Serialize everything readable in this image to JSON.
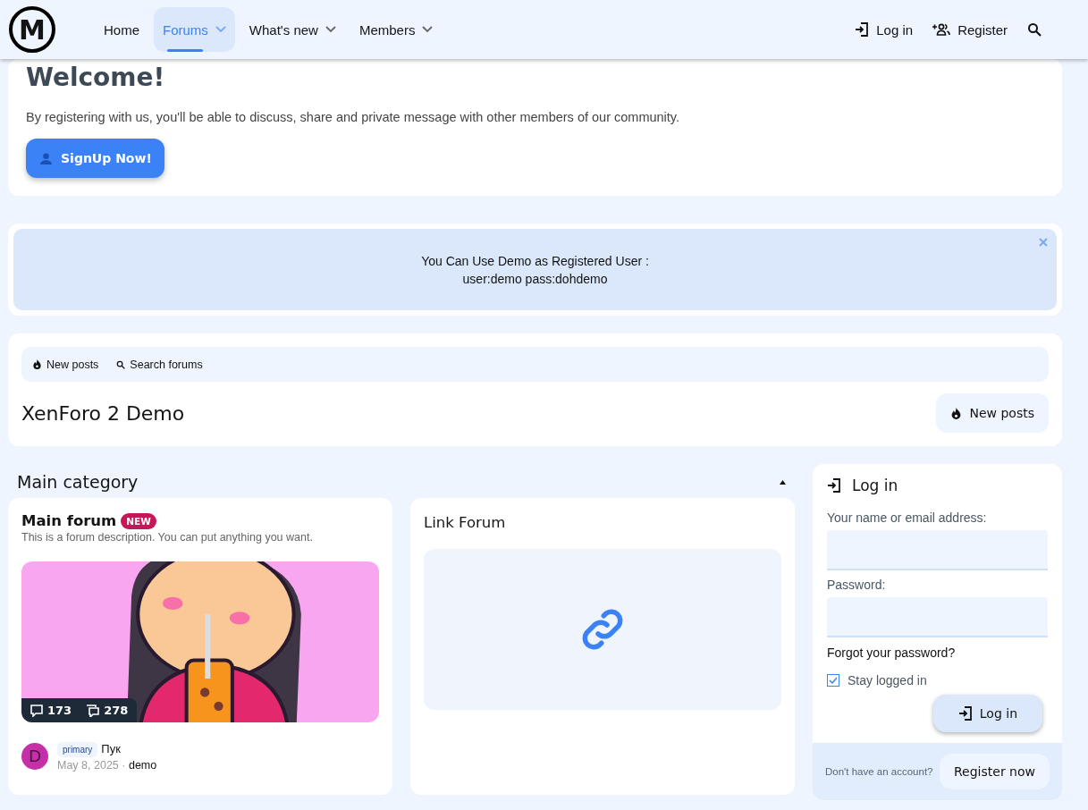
{
  "header": {
    "logo_text": "M",
    "nav": [
      {
        "label": "Home",
        "selected": false,
        "dropdown": false
      },
      {
        "label": "Forums",
        "selected": true,
        "dropdown": true
      },
      {
        "label": "What's new",
        "selected": false,
        "dropdown": true
      },
      {
        "label": "Members",
        "selected": false,
        "dropdown": true
      }
    ],
    "actions": [
      {
        "label": "Log in",
        "kind": "login"
      },
      {
        "label": "Register",
        "kind": "register"
      }
    ]
  },
  "welcome": {
    "title": "Welcome!",
    "text": "By registering with us, you'll be able to discuss, share and private message with other members of our community.",
    "button": "SignUp Now!"
  },
  "notice": {
    "lines": [
      "You Can Use Demo as Registered User :",
      "user:demo pass:dohdemo"
    ]
  },
  "forum_bar": {
    "links": [
      {
        "label": "New posts",
        "kind": "fire"
      },
      {
        "label": "Search forums",
        "kind": "search"
      }
    ],
    "title": "XenForo 2 Demo",
    "button": "New posts"
  },
  "category": {
    "title": "Main category",
    "expanded": true,
    "forums": [
      {
        "kind": "forum",
        "title": "Main forum",
        "badge": "NEW",
        "description": "This is a forum description. You can put anything you want.",
        "stats": [
          "173",
          "278"
        ],
        "last_post": {
          "avatar": "D",
          "color": "#c530a8",
          "prefix": "primary",
          "title": "Пук",
          "date": "May 8, 2025",
          "separator": "·",
          "user": "demo"
        }
      },
      {
        "kind": "link",
        "title": "Link Forum"
      }
    ]
  },
  "login": {
    "title": "Log in",
    "name_label": "Your name or email address:",
    "password_label": "Password:",
    "forgot": "Forgot your password?",
    "stay": {
      "label": "Stay logged in",
      "checked": true
    },
    "button": "Log in",
    "footer_text": "Don't have an account?",
    "register": "Register now"
  }
}
